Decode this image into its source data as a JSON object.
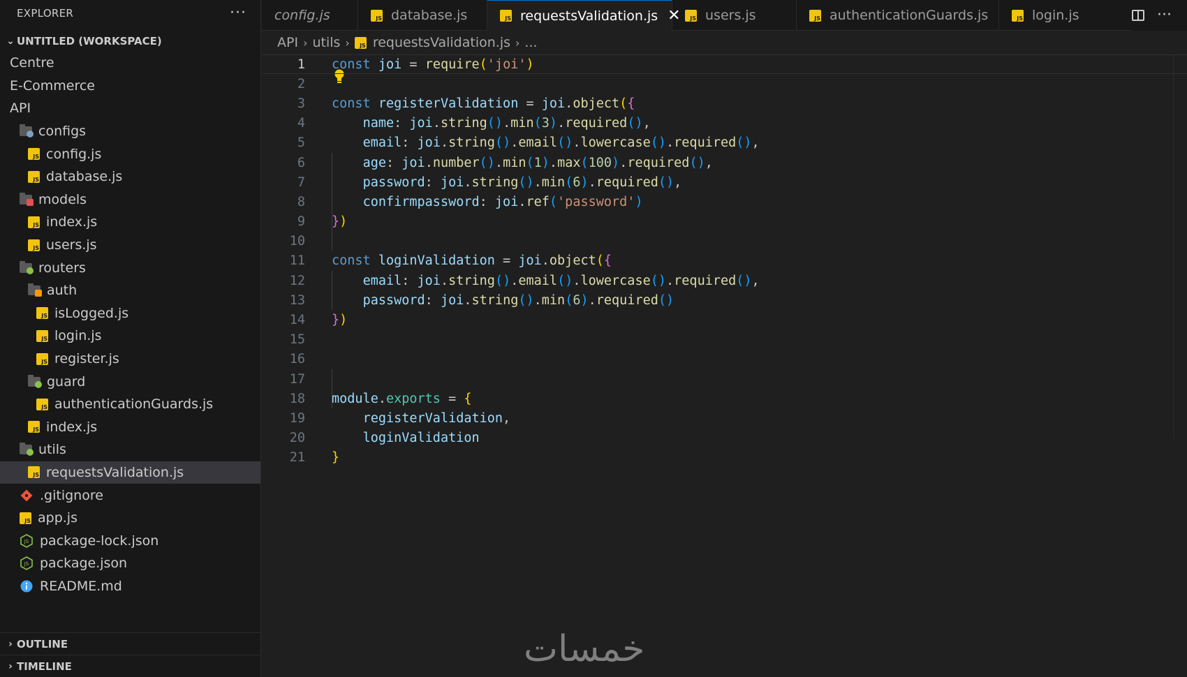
{
  "sidebar": {
    "title": "EXPLORER",
    "more": "···",
    "workspace": "UNTITLED (WORKSPACE)",
    "items": [
      {
        "label": "Centre",
        "type": "root"
      },
      {
        "label": "E-Commerce",
        "type": "root"
      },
      {
        "label": "API",
        "type": "root"
      },
      {
        "label": "configs",
        "type": "folder",
        "badge": "gear",
        "badge_color": "#7f9fbf"
      },
      {
        "label": "config.js",
        "type": "js"
      },
      {
        "label": "database.js",
        "type": "js"
      },
      {
        "label": "models",
        "type": "folder",
        "badge": "db",
        "badge_color": "#e05252"
      },
      {
        "label": "index.js",
        "type": "js"
      },
      {
        "label": "users.js",
        "type": "js"
      },
      {
        "label": "routers",
        "type": "folder",
        "badge": "fork",
        "badge_color": "#8bc34a"
      },
      {
        "label": "auth",
        "type": "folder",
        "badge": "lock",
        "badge_color": "#ff9800"
      },
      {
        "label": "isLogged.js",
        "type": "js"
      },
      {
        "label": "login.js",
        "type": "js"
      },
      {
        "label": "register.js",
        "type": "js"
      },
      {
        "label": "guard",
        "type": "folder",
        "badge": "shield",
        "badge_color": "#8bc34a"
      },
      {
        "label": "authenticationGuards.js",
        "type": "js"
      },
      {
        "label": "index.js",
        "type": "js"
      },
      {
        "label": "utils",
        "type": "folder",
        "badge": "tool",
        "badge_color": "#8bc34a"
      },
      {
        "label": "requestsValidation.js",
        "type": "js"
      },
      {
        "label": ".gitignore",
        "type": "git"
      },
      {
        "label": "app.js",
        "type": "js"
      },
      {
        "label": "package-lock.json",
        "type": "node"
      },
      {
        "label": "package.json",
        "type": "node"
      },
      {
        "label": "README.md",
        "type": "info"
      }
    ],
    "outline": "OUTLINE",
    "timeline": "TIMELINE"
  },
  "tabs": [
    {
      "label": "config.js",
      "italic": true
    },
    {
      "label": "database.js"
    },
    {
      "label": "requestsValidation.js",
      "active": true,
      "close": "✕"
    },
    {
      "label": "users.js"
    },
    {
      "label": "authenticationGuards.js"
    },
    {
      "label": "login.js"
    }
  ],
  "tab_more": "···",
  "breadcrumb": {
    "parts": [
      "API",
      "utils"
    ],
    "file": "requestsValidation.js",
    "tail": "..."
  },
  "editor": {
    "line_numbers": [
      "1",
      "2",
      "3",
      "4",
      "5",
      "6",
      "7",
      "8",
      "9",
      "10",
      "11",
      "12",
      "13",
      "14",
      "15",
      "16",
      "17",
      "18",
      "19",
      "20",
      "21"
    ],
    "current_line": "1"
  },
  "watermark": "خمسات",
  "colors": {
    "keyword": "#569cd6",
    "variable": "#9cdcfe",
    "function": "#dcdcaa",
    "string": "#ce9178",
    "number": "#b5cea8",
    "bracket_gold": "#ffd700",
    "bracket_purple": "#da70d6",
    "bracket_blue": "#179fff",
    "js_icon": "#f1c40f",
    "accent": "#0078d4"
  }
}
